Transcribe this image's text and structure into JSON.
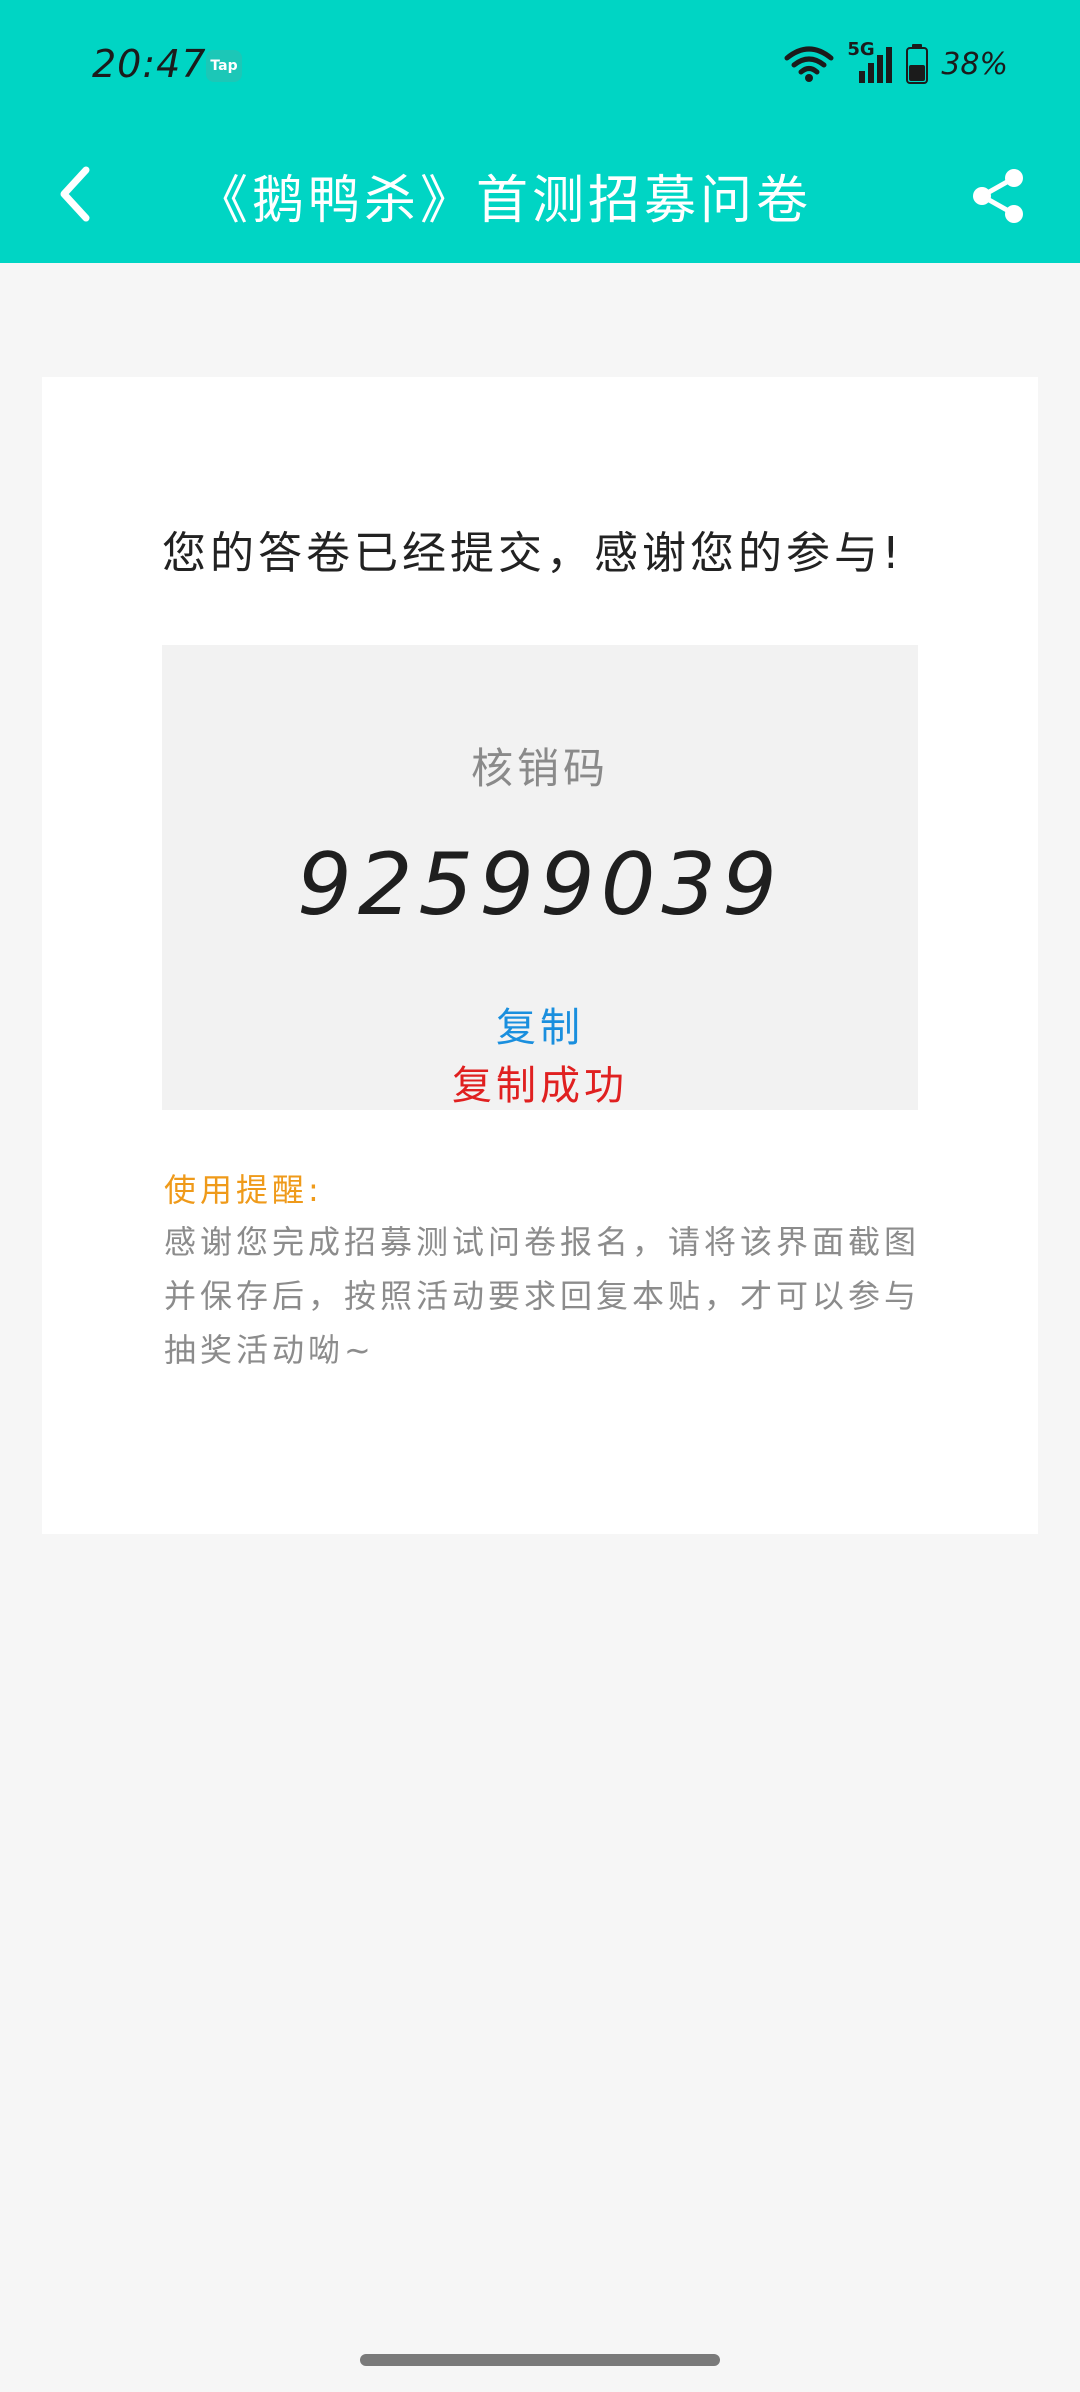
{
  "status_bar": {
    "time": "20:47",
    "app_badge": "Tap",
    "network": "5G",
    "battery": "38%"
  },
  "app_bar": {
    "title": "《鹅鸭杀》首测招募问卷",
    "back_icon": "chevron-left-icon",
    "share_icon": "share-icon"
  },
  "card": {
    "submit_message": "您的答卷已经提交，感谢您的参与!",
    "code_label": "核销码",
    "code_value": "92599039",
    "copy_label": "复制",
    "copy_success": "复制成功",
    "tip_title": "使用提醒:",
    "tip_body": "感谢您完成招募测试问卷报名，请将该界面截图并保存后，按照活动要求回复本贴，才可以参与抽奖活动呦~"
  },
  "colors": {
    "header_bg": "#00d5c4",
    "page_bg": "#f6f6f6",
    "copy_link": "#1a8fde",
    "copy_success": "#e02020",
    "tip_title": "#ef9a1a"
  }
}
